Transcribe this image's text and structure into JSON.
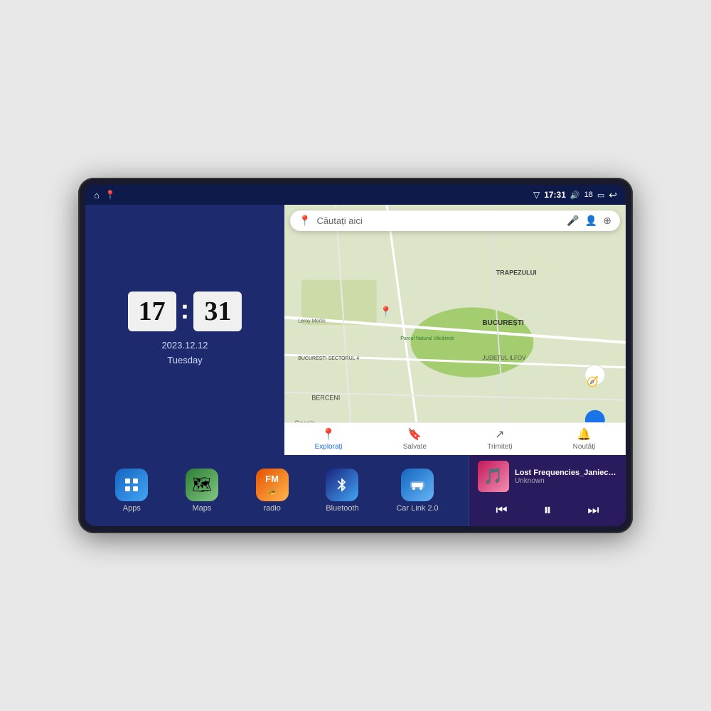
{
  "device": {
    "status_bar": {
      "left_icons": [
        "home-icon",
        "maps-pin-icon"
      ],
      "time": "17:31",
      "signal_icon": "signal-icon",
      "volume_icon": "volume-icon",
      "volume_level": "18",
      "battery_icon": "battery-icon",
      "back_icon": "back-icon"
    },
    "clock": {
      "hours": "17",
      "minutes": "31",
      "date": "2023.12.12",
      "day": "Tuesday"
    },
    "map": {
      "search_placeholder": "Căutați aici",
      "nav_items": [
        {
          "label": "Explorați",
          "active": true
        },
        {
          "label": "Salvate",
          "active": false
        },
        {
          "label": "Trimiteți",
          "active": false
        },
        {
          "label": "Noutăți",
          "active": false
        }
      ],
      "location_labels": [
        "TRAPEZULUI",
        "BUCUREȘTI",
        "JUDEȚUL ILFOV",
        "BERCENI",
        "Parcul Natural Văcărești",
        "Leroy Merlin",
        "BUCUREȘTI SECTORUL 4"
      ]
    },
    "apps": [
      {
        "id": "apps",
        "label": "Apps",
        "icon": "grid-icon",
        "bg_class": "app-icon-apps"
      },
      {
        "id": "maps",
        "label": "Maps",
        "icon": "map-icon",
        "bg_class": "app-icon-maps"
      },
      {
        "id": "radio",
        "label": "radio",
        "icon": "radio-icon",
        "bg_class": "app-icon-radio"
      },
      {
        "id": "bluetooth",
        "label": "Bluetooth",
        "icon": "bluetooth-icon",
        "bg_class": "app-icon-bluetooth"
      },
      {
        "id": "carlink",
        "label": "Car Link 2.0",
        "icon": "car-icon",
        "bg_class": "app-icon-carlink"
      }
    ],
    "music": {
      "title": "Lost Frequencies_Janieck Devy-...",
      "artist": "Unknown",
      "controls": [
        "prev",
        "play",
        "next"
      ]
    }
  }
}
